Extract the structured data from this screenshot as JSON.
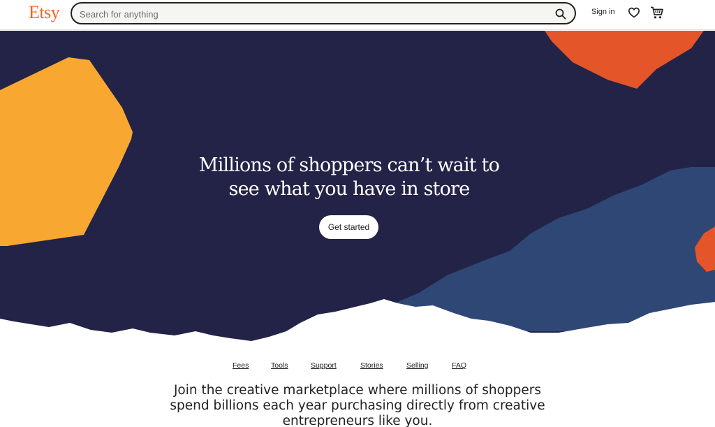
{
  "header": {
    "logo": "Etsy",
    "search": {
      "placeholder": "Search for anything",
      "value": ""
    },
    "sign_in": "Sign in"
  },
  "hero": {
    "headline_line1": "Millions of shoppers can’t wait to",
    "headline_line2": "see what you have in store",
    "cta": "Get started",
    "colors": {
      "background": "#232347",
      "yellow": "#f8a831",
      "orange": "#e4552a",
      "blue": "#2f4775"
    }
  },
  "nav_links": [
    "Fees",
    "Tools",
    "Support",
    "Stories",
    "Selling",
    "FAQ"
  ],
  "tagline": {
    "line1": "Join the creative marketplace where millions of shoppers",
    "line2": "spend billions each year purchasing directly from creative",
    "line3": "entrepreneurs like you."
  },
  "icons": [
    "search-icon",
    "heart-icon",
    "cart-icon"
  ]
}
